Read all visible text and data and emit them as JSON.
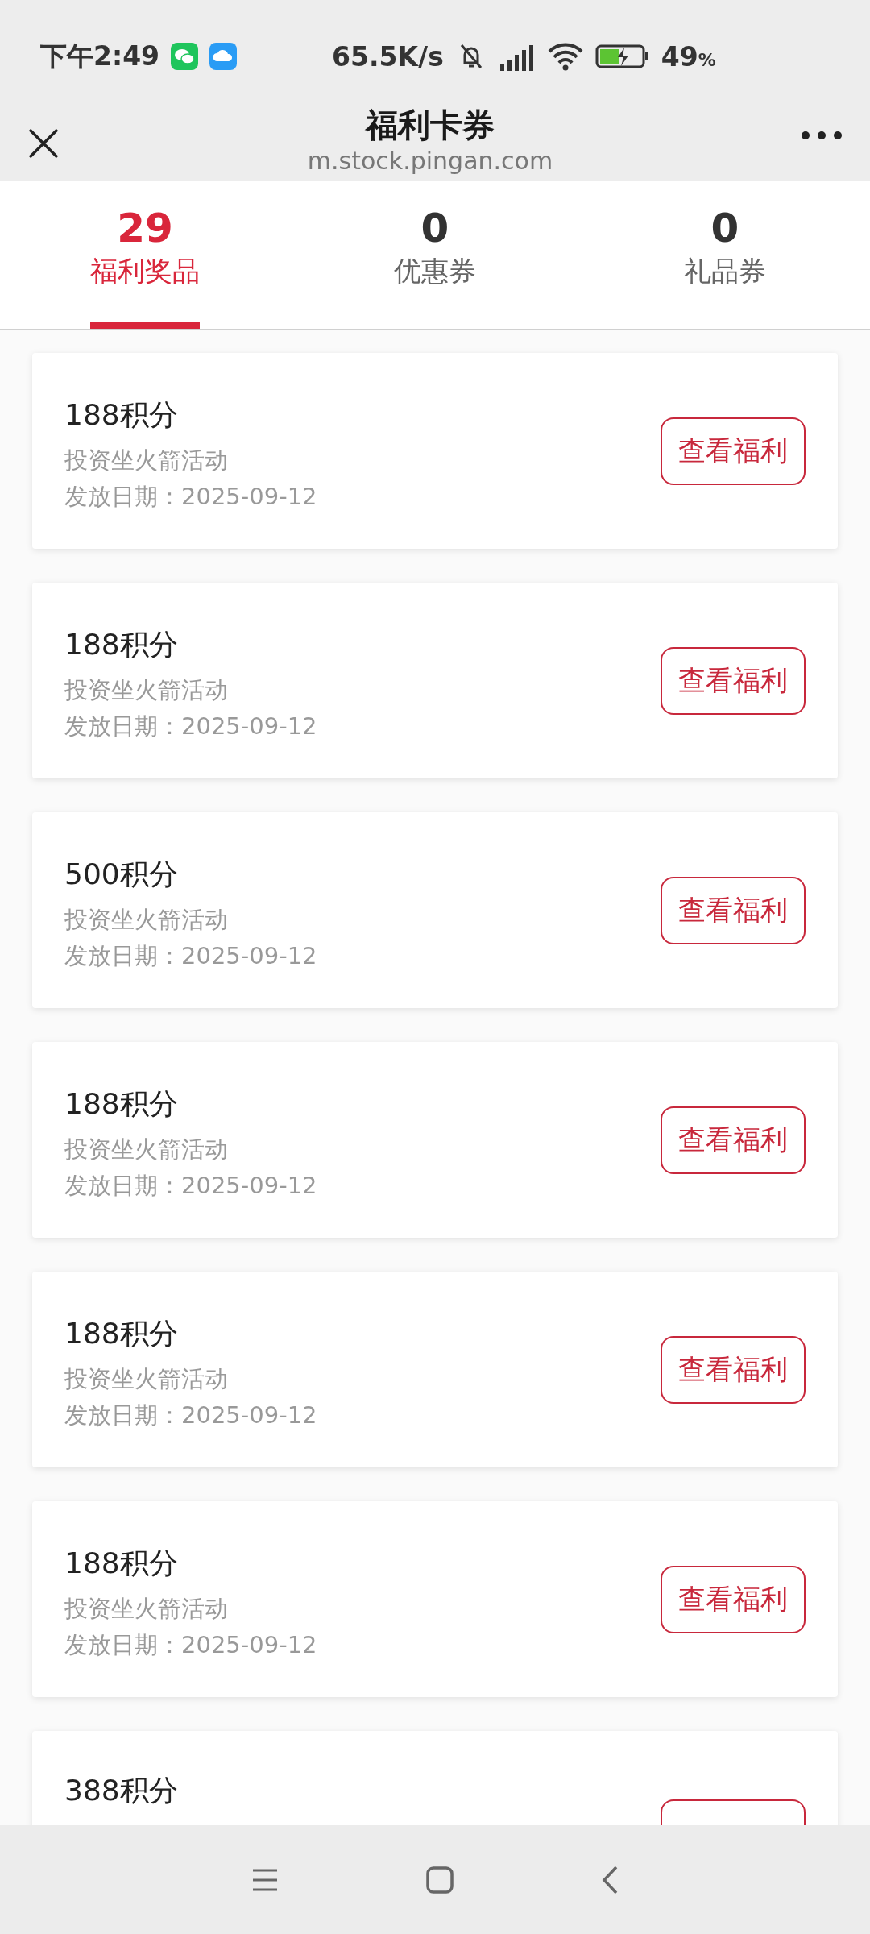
{
  "status_bar": {
    "time": "下午2:49",
    "speed": "65.5K/s",
    "battery": "49",
    "battery_unit": "%"
  },
  "header": {
    "title": "福利卡券",
    "url": "m.stock.pingan.com"
  },
  "tabs": [
    {
      "count": "29",
      "label": "福利奖品",
      "selected": true
    },
    {
      "count": "0",
      "label": "优惠券",
      "selected": false
    },
    {
      "count": "0",
      "label": "礼品券",
      "selected": false
    }
  ],
  "cards": [
    {
      "title": "188积分",
      "activity": "投资坐火箭活动",
      "date": "发放日期：2025-09-12",
      "button": "查看福利"
    },
    {
      "title": "188积分",
      "activity": "投资坐火箭活动",
      "date": "发放日期：2025-09-12",
      "button": "查看福利"
    },
    {
      "title": "500积分",
      "activity": "投资坐火箭活动",
      "date": "发放日期：2025-09-12",
      "button": "查看福利"
    },
    {
      "title": "188积分",
      "activity": "投资坐火箭活动",
      "date": "发放日期：2025-09-12",
      "button": "查看福利"
    },
    {
      "title": "188积分",
      "activity": "投资坐火箭活动",
      "date": "发放日期：2025-09-12",
      "button": "查看福利"
    },
    {
      "title": "188积分",
      "activity": "投资坐火箭活动",
      "date": "发放日期：2025-09-12",
      "button": "查看福利"
    },
    {
      "title": "388积分"
    }
  ]
}
